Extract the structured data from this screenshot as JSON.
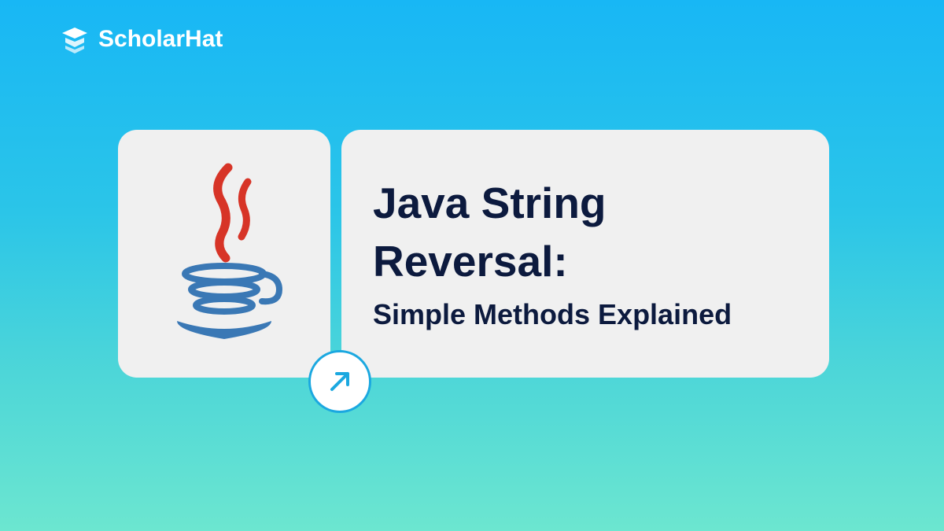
{
  "brand": {
    "name": "ScholarHat"
  },
  "content": {
    "title_line": "Java String Reversal:",
    "subtitle": "Simple Methods Explained"
  },
  "icons": {
    "logo": "scholarhat-logo",
    "main_app": "java-logo",
    "arrow": "arrow-up-right"
  },
  "colors": {
    "text_dark": "#0c1a3e",
    "accent_blue": "#1ba8e0",
    "card_bg": "#f0f0f0"
  }
}
